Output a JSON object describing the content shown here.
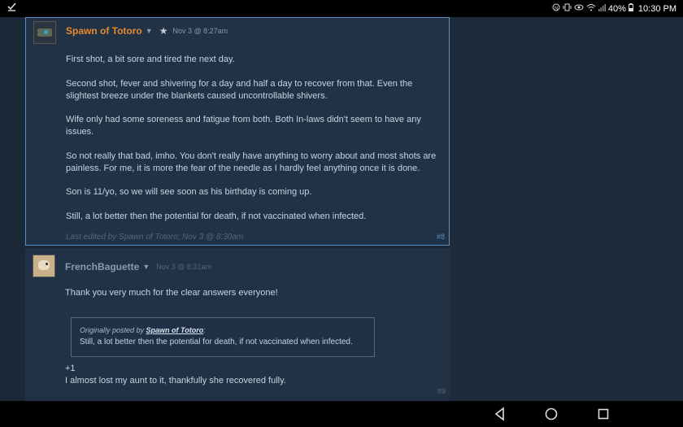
{
  "status_bar": {
    "battery": "40%",
    "time": "10:30 PM",
    "icons": [
      "download-icon",
      "nfc-icon",
      "vibrate-icon",
      "eye-icon",
      "wifi-icon",
      "signal-icon",
      "battery-icon"
    ]
  },
  "posts": [
    {
      "author": "Spawn of Totoro",
      "date": "Nov 3 @ 8:27am",
      "paragraphs": [
        "First shot, a bit sore and tired the next day.",
        "Second shot, fever and shivering for a day and half a day to recover from that. Even the slightest breeze under the blankets caused uncontrollable shivers.",
        "Wife only had some soreness and fatigue from both. Both In-laws didn't seem to have any issues.",
        "So not really that bad, imho. You don't really have anything to worry about and most shots are painless. For me, it is more the fear of the needle as I hardly feel anything once it is done.",
        "Son is 11/yo, so we will see soon as his birthday is coming up.",
        "Still, a lot better then the potential for death, if not vaccinated when infected."
      ],
      "edited": "Last edited by Spawn of Totoro; Nov 3 @ 8:30am",
      "number": "#8"
    },
    {
      "author": "FrenchBaguette",
      "date": "Nov 3 @ 8:31am",
      "text": "Thank you very much for the clear answers everyone!",
      "quote": {
        "prefix": "Originally posted by ",
        "author": "Spawn of Totoro",
        "suffix": ":",
        "text": "Still, a lot better then the potential for death, if not vaccinated when infected."
      },
      "reply_lines": [
        "+1",
        "I almost lost my aunt to it, thankfully she recovered fully."
      ],
      "number": "#9"
    }
  ],
  "nav": {
    "buttons": [
      "back-icon",
      "home-icon",
      "recents-icon"
    ]
  }
}
